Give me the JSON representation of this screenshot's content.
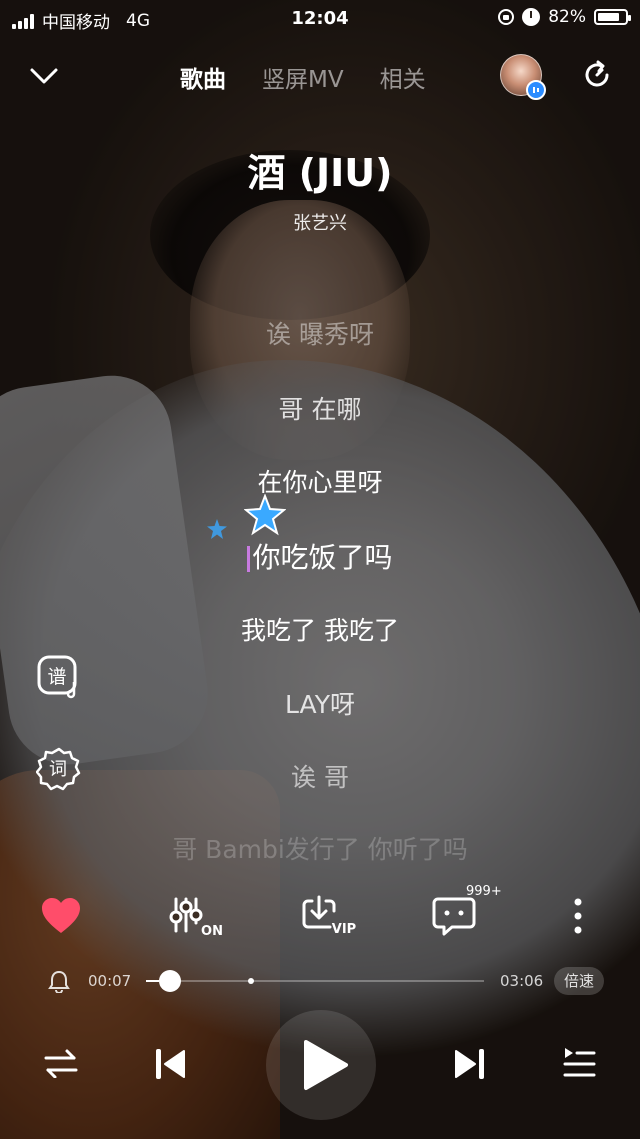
{
  "status_bar": {
    "carrier": "中国移动",
    "network": "4G",
    "time": "12:04",
    "battery": "82%",
    "battery_level": 0.82
  },
  "nav": {
    "tabs": [
      {
        "label": "歌曲",
        "active": true
      },
      {
        "label": "竖屏MV",
        "active": false
      },
      {
        "label": "相关",
        "active": false
      }
    ]
  },
  "song": {
    "title": "酒 (JIU)",
    "artist": "张艺兴"
  },
  "lyrics": [
    "诶 曝秀呀",
    "哥 在哪",
    "在你心里呀",
    "你吃饭了吗",
    "我吃了 我吃了",
    "LAY呀",
    "诶 哥",
    "哥 Bambi发行了 你听了吗"
  ],
  "side_buttons": {
    "score": "谱",
    "lyrics": "词"
  },
  "actions": {
    "comment_count": "999+",
    "equalizer_label": "ON",
    "download_label": "VIP"
  },
  "playback": {
    "current_time": "00:07",
    "total_time": "03:06",
    "progress": 0.038,
    "marker": 0.31,
    "speed_label": "倍速"
  },
  "colors": {
    "heart": "#ff4d6a",
    "star": "#3aa9ff",
    "avatar_badge": "#2b8cff"
  }
}
